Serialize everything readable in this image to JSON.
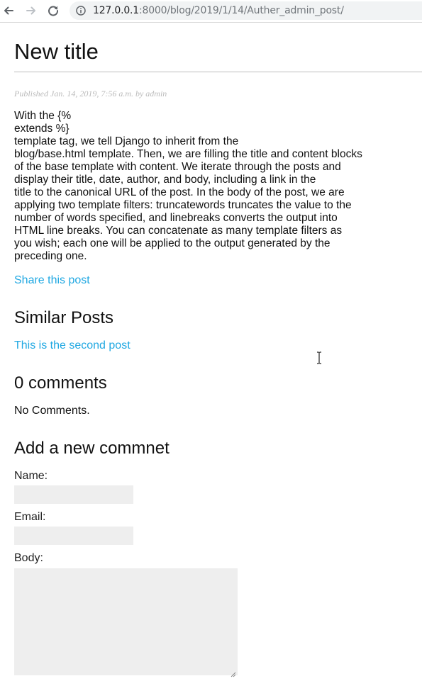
{
  "browser": {
    "url_host": "127.0.0.1",
    "url_rest": ":8000/blog/2019/1/14/Auther_admin_post/"
  },
  "post": {
    "title": "New title",
    "published": "Published Jan. 14, 2019, 7:56 a.m. by admin",
    "body_lines": [
      "With the {%",
      "extends %}",
      "template tag, we tell Django to inherit from the",
      "blog/base.html template. Then, we are filling the title and content blocks",
      "of the base template with content. We iterate through the posts and",
      "display their title, date, author, and body, including a link in the",
      "title to the canonical URL of the post. In the body of the post, we are",
      "applying two template filters: truncatewords truncates the value to the",
      "number of words specified, and linebreaks converts the output into",
      "HTML line breaks. You can concatenate as many template filters as",
      "you wish; each one will be applied to the output generated by the",
      "preceding one."
    ],
    "share_label": "Share this post"
  },
  "similar": {
    "heading": "Similar Posts",
    "items": [
      "This is the second post"
    ]
  },
  "comments": {
    "heading": "0 comments",
    "empty_text": "No Comments."
  },
  "form": {
    "heading": "Add a new commnet",
    "name_label": "Name:",
    "email_label": "Email:",
    "body_label": "Body:"
  },
  "colors": {
    "link": "#20a8e2",
    "input_bg": "#eeeeee"
  }
}
